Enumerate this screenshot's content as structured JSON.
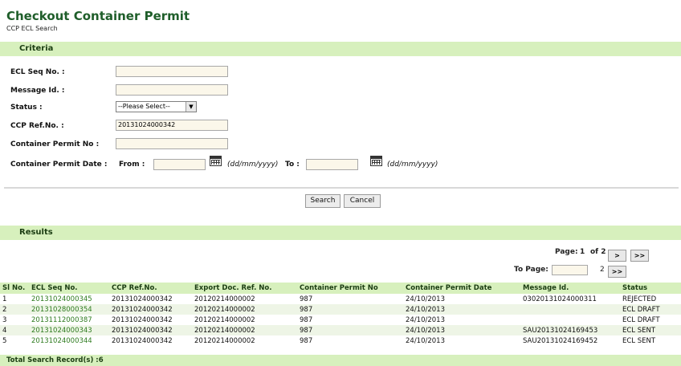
{
  "page": {
    "title": "Checkout Container Permit",
    "subtitle": "CCP ECL Search"
  },
  "criteria": {
    "heading": "Criteria",
    "ecl_seq_label": "ECL Seq No. :",
    "ecl_seq_value": "",
    "message_id_label": "Message Id. :",
    "message_id_value": "",
    "status_label": "Status :",
    "status_selected": "--Please Select--",
    "ccp_ref_label": "CCP Ref.No. :",
    "ccp_ref_value": "20131024000342",
    "permit_no_label": "Container Permit No :",
    "permit_no_value": "",
    "permit_date_label": "Container Permit Date :",
    "from_label": "From :",
    "to_label": "To :",
    "date_format": "(dd/mm/yyyy)"
  },
  "actions": {
    "search": "Search",
    "cancel": "Cancel"
  },
  "results": {
    "heading": "Results",
    "page_label": "Page:",
    "page_current": "1",
    "page_of": "of 2",
    "next": ">",
    "last": ">>",
    "to_page_label": "To Page:",
    "to_page_value": "",
    "to_page_max": "2",
    "go": ">>",
    "columns": [
      "Sl No.",
      "ECL Seq No.",
      "CCP Ref.No.",
      "Export Doc. Ref. No.",
      "Container Permit No",
      "Container Permit Date",
      "Message Id.",
      "Status"
    ],
    "rows": [
      [
        "1",
        "20131024000345",
        "20131024000342",
        "20120214000002",
        "987",
        "24/10/2013",
        "03020131024000311",
        "REJECTED"
      ],
      [
        "2",
        "20131028000354",
        "20131024000342",
        "20120214000002",
        "987",
        "24/10/2013",
        "",
        "ECL DRAFT"
      ],
      [
        "3",
        "20131112000387",
        "20131024000342",
        "20120214000002",
        "987",
        "24/10/2013",
        "",
        "ECL DRAFT"
      ],
      [
        "4",
        "20131024000343",
        "20131024000342",
        "20120214000002",
        "987",
        "24/10/2013",
        "SAU20131024169453",
        "ECL SENT"
      ],
      [
        "5",
        "20131024000344",
        "20131024000342",
        "20120214000002",
        "987",
        "24/10/2013",
        "SAU20131024169452",
        "ECL SENT"
      ]
    ],
    "total": "Total Search Record(s) :6"
  },
  "colors": {
    "accent": "#d7f0bd",
    "title": "#1f5e2a",
    "link": "#2e7b1f"
  },
  "icons": {
    "calendar": "calendar-icon"
  }
}
